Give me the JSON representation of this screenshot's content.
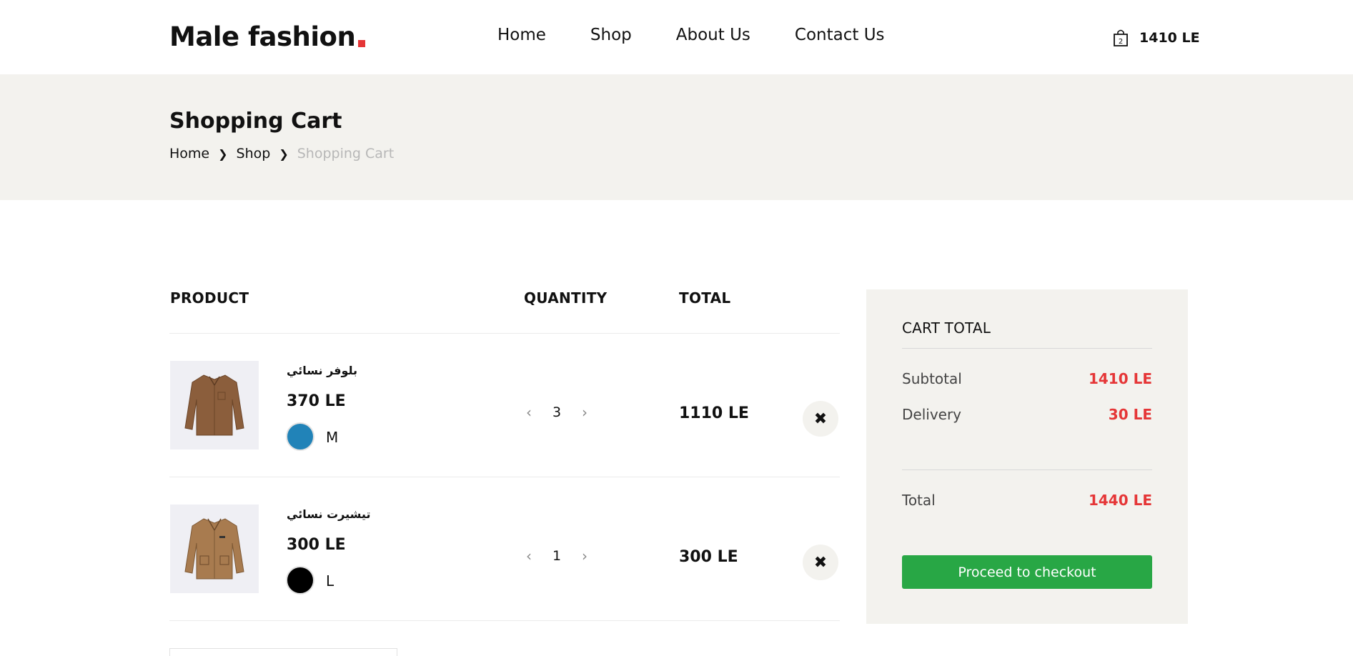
{
  "header": {
    "logo_text": "Male fashion",
    "nav": [
      {
        "label": "Home"
      },
      {
        "label": "Shop"
      },
      {
        "label": "About Us"
      },
      {
        "label": "Contact Us"
      }
    ],
    "cart_count": "2",
    "cart_amount": "1410 LE"
  },
  "banner": {
    "title": "Shopping Cart",
    "breadcrumb": [
      "Home",
      "Shop",
      "Shopping Cart"
    ]
  },
  "table": {
    "headers": {
      "product": "PRODUCT",
      "quantity": "QUANTITY",
      "total": "TOTAL"
    },
    "rows": [
      {
        "name": "بلوفر نسائي",
        "price": "370 LE",
        "color": "#2183b8",
        "size": "M",
        "quantity": "3",
        "total": "1110 LE",
        "image_icon": "brown-shirt-image"
      },
      {
        "name": "تيشيرت نسائي",
        "price": "300 LE",
        "color": "#000000",
        "size": "L",
        "quantity": "1",
        "total": "300 LE",
        "image_icon": "tan-jacket-image"
      }
    ],
    "prev_icon": "‹",
    "next_icon": "›",
    "remove_icon": "✖"
  },
  "totals": {
    "title": "CART TOTAL",
    "subtotal_label": "Subtotal",
    "subtotal_value": "1410 LE",
    "delivery_label": "Delivery",
    "delivery_value": "30 LE",
    "total_label": "Total",
    "total_value": "1440 LE",
    "checkout_label": "Proceed to checkout"
  },
  "colors": {
    "accent": "#e53637",
    "checkout": "#28a745",
    "banner_bg": "#f3f2ee"
  }
}
